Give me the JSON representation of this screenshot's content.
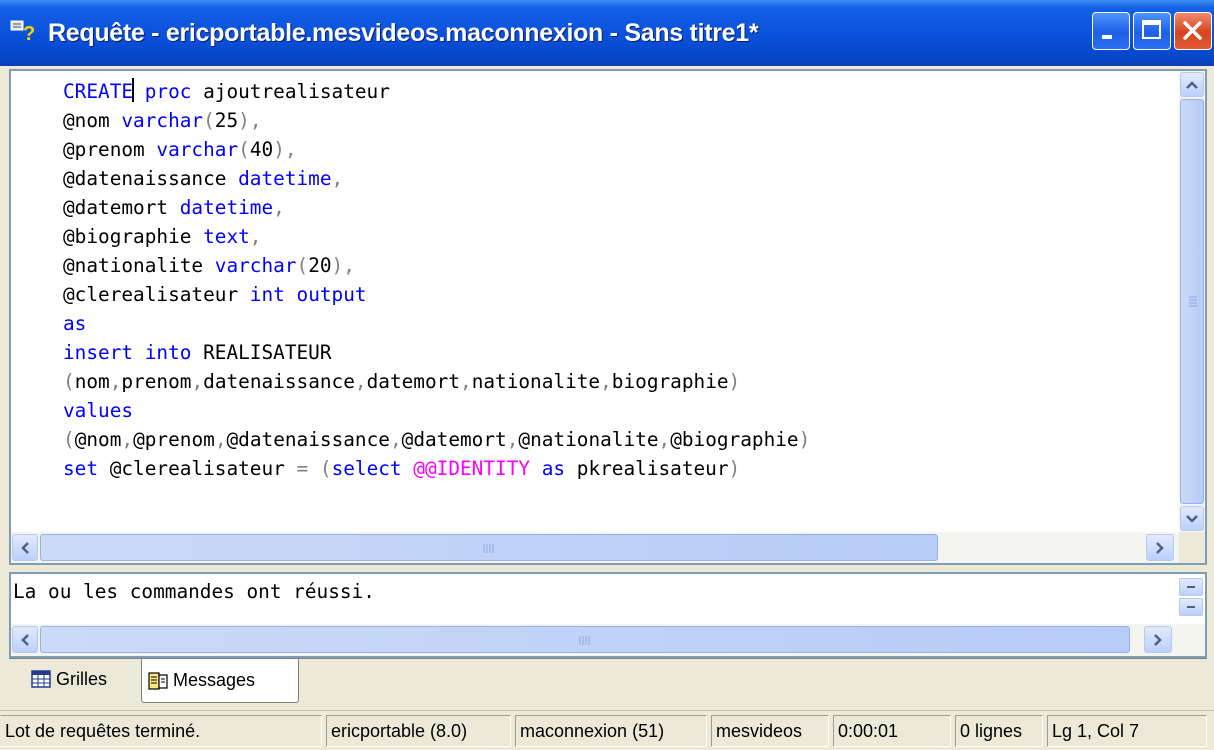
{
  "window": {
    "title": "Requête - ericportable.mesvideos.maconnexion - Sans titre1*"
  },
  "editor": {
    "lines": [
      [
        {
          "t": "CREATE",
          "c": "kw"
        },
        {
          "caret": true
        },
        {
          "t": " "
        },
        {
          "t": "proc",
          "c": "kw"
        },
        {
          "t": " ajoutrealisateur"
        }
      ],
      [
        {
          "t": "@nom "
        },
        {
          "t": "varchar",
          "c": "kw"
        },
        {
          "t": "(",
          "c": "op"
        },
        {
          "t": "25"
        },
        {
          "t": "),",
          "c": "op"
        }
      ],
      [
        {
          "t": "@prenom "
        },
        {
          "t": "varchar",
          "c": "kw"
        },
        {
          "t": "(",
          "c": "op"
        },
        {
          "t": "40"
        },
        {
          "t": "),",
          "c": "op"
        }
      ],
      [
        {
          "t": "@datenaissance "
        },
        {
          "t": "datetime",
          "c": "kw"
        },
        {
          "t": ",",
          "c": "op"
        }
      ],
      [
        {
          "t": "@datemort "
        },
        {
          "t": "datetime",
          "c": "kw"
        },
        {
          "t": ",",
          "c": "op"
        }
      ],
      [
        {
          "t": "@biographie "
        },
        {
          "t": "text",
          "c": "kw"
        },
        {
          "t": ",",
          "c": "op"
        }
      ],
      [
        {
          "t": "@nationalite "
        },
        {
          "t": "varchar",
          "c": "kw"
        },
        {
          "t": "(",
          "c": "op"
        },
        {
          "t": "20"
        },
        {
          "t": "),",
          "c": "op"
        }
      ],
      [
        {
          "t": "@clerealisateur "
        },
        {
          "t": "int",
          "c": "kw"
        },
        {
          "t": " "
        },
        {
          "t": "output",
          "c": "kw"
        }
      ],
      [
        {
          "t": "as",
          "c": "kw"
        }
      ],
      [
        {
          "t": "insert",
          "c": "kw"
        },
        {
          "t": " "
        },
        {
          "t": "into",
          "c": "kw"
        },
        {
          "t": " REALISATEUR"
        }
      ],
      [
        {
          "t": "(",
          "c": "op"
        },
        {
          "t": "nom"
        },
        {
          "t": ",",
          "c": "op"
        },
        {
          "t": "prenom"
        },
        {
          "t": ",",
          "c": "op"
        },
        {
          "t": "datenaissance"
        },
        {
          "t": ",",
          "c": "op"
        },
        {
          "t": "datemort"
        },
        {
          "t": ",",
          "c": "op"
        },
        {
          "t": "nationalite"
        },
        {
          "t": ",",
          "c": "op"
        },
        {
          "t": "biographie"
        },
        {
          "t": ")",
          "c": "op"
        }
      ],
      [
        {
          "t": "values",
          "c": "kw"
        }
      ],
      [
        {
          "t": "(",
          "c": "op"
        },
        {
          "t": "@nom"
        },
        {
          "t": ",",
          "c": "op"
        },
        {
          "t": "@prenom"
        },
        {
          "t": ",",
          "c": "op"
        },
        {
          "t": "@datenaissance"
        },
        {
          "t": ",",
          "c": "op"
        },
        {
          "t": "@datemort"
        },
        {
          "t": ",",
          "c": "op"
        },
        {
          "t": "@nationalite"
        },
        {
          "t": ",",
          "c": "op"
        },
        {
          "t": "@biographie"
        },
        {
          "t": ")",
          "c": "op"
        }
      ],
      [
        {
          "t": "set",
          "c": "kw"
        },
        {
          "t": " @clerealisateur "
        },
        {
          "t": "=",
          "c": "op"
        },
        {
          "t": " "
        },
        {
          "t": "(",
          "c": "op"
        },
        {
          "t": "select",
          "c": "kw"
        },
        {
          "t": " "
        },
        {
          "t": "@@IDENTITY",
          "c": "sys"
        },
        {
          "t": " "
        },
        {
          "t": "as",
          "c": "kw"
        },
        {
          "t": " pkrealisateur"
        },
        {
          "t": ")",
          "c": "op"
        }
      ]
    ],
    "colors": {
      "keyword": "#0000ff",
      "operator": "#808080",
      "system_function": "#ff00ff",
      "text": "#000000"
    }
  },
  "results": {
    "message": "La ou les commandes ont réussi."
  },
  "tabs": [
    {
      "label": "Grilles",
      "icon": "grid-icon",
      "active": false
    },
    {
      "label": "Messages",
      "icon": "messages-icon",
      "active": true
    }
  ],
  "statusbar": {
    "status": "Lot de requêtes terminé.",
    "server": "ericportable (8.0)",
    "connection": "maconnexion (51)",
    "database": "mesvideos",
    "elapsed": "0:00:01",
    "rows": "0 lignes",
    "position": "Lg 1, Col 7"
  },
  "theme": {
    "titlebar": "#0a52dc",
    "close_button": "#d6441f",
    "window_face": "#ece9d8",
    "border": "#7f9db9"
  }
}
